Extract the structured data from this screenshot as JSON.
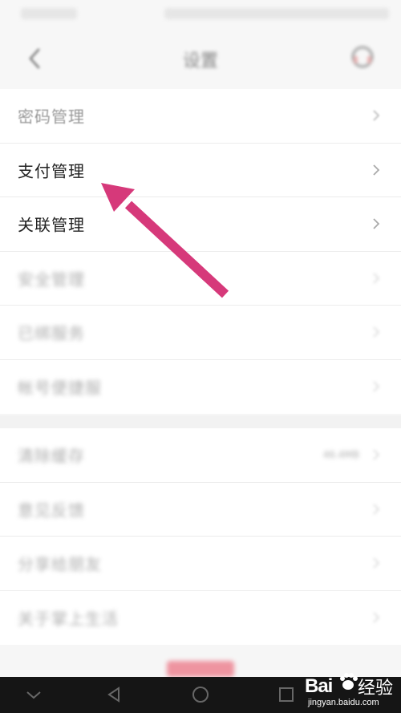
{
  "header": {
    "title": "设置"
  },
  "group1": {
    "items": [
      {
        "label": "密码管理"
      },
      {
        "label": "支付管理"
      },
      {
        "label": "关联管理"
      },
      {
        "label": "安全管理"
      },
      {
        "label": "已绑服务"
      },
      {
        "label": "帐号便捷服"
      }
    ]
  },
  "group2": {
    "items": [
      {
        "label": "清除缓存",
        "value": "46.4MB"
      },
      {
        "label": "意见反馈"
      },
      {
        "label": "分享给朋友"
      },
      {
        "label": "关于掌上生活"
      }
    ]
  },
  "watermark": {
    "brand": "Bai",
    "brand_suffix": "经验",
    "url": "jingyan.baidu.com"
  },
  "colors": {
    "arrow": "#d6397a",
    "background": "#f6f6f6",
    "bottom_bar": "#151515"
  }
}
